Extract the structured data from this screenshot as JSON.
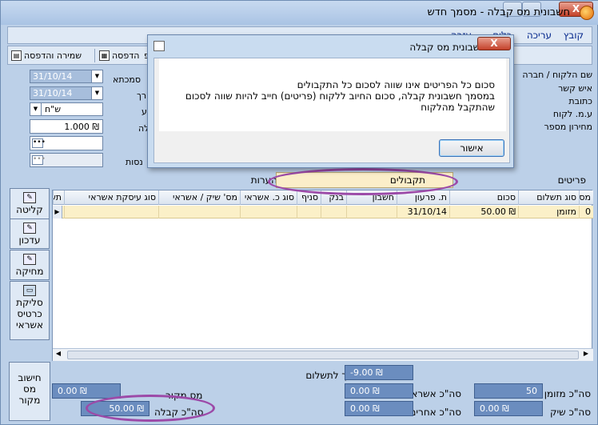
{
  "window": {
    "title": "חשבונית מס קבלה  -  מסמך חדש",
    "close": "X"
  },
  "menu": [
    "קובץ",
    "עריכה",
    "כלים",
    "עזרה"
  ],
  "toolbar": {
    "save_print": "שמירה והדפסה",
    "print": "הדפסה",
    "cut_label": "הכפ"
  },
  "header": {
    "customer_name": "שם הלקוח / חברה",
    "contact": "איש קשר",
    "address": "כתובת",
    "vat_id": "ע.מ. לקוח",
    "price_list": "מחירון מספר",
    "doc_label_cut": "סמכתא",
    "date_label_cut": "רך",
    "cur_label_cut": "ע",
    "rate_label_cut": "לה",
    "income_label_cut": "נסות",
    "date1": "31/10/14",
    "date2": "31/10/14",
    "currency": "ש\"ח",
    "rate": "1.000 ₪",
    "field_dots": "•••",
    "field_dots2": "•••"
  },
  "tabs": {
    "items": "פריטים",
    "notes": "הערות",
    "receipts": "תקבולים"
  },
  "side": {
    "receive": "קליטה",
    "update": "עדכון",
    "delete": "מחיקה",
    "swipe": "סליקת כרטיס אשראי"
  },
  "grid": {
    "columns": [
      "מס'",
      "סוג תשלום",
      "סכום",
      "ת. פרעון",
      "חשבון",
      "בנק",
      "סניף",
      "סוג כ. אשראי",
      "מס' שיק / אשראי",
      "סוג עיסקת אשראי",
      "תש"
    ],
    "row": [
      "0",
      "מזומן",
      "50.00 ₪",
      "31/10/14",
      "",
      "",
      "",
      "",
      "",
      "",
      ""
    ]
  },
  "bottom": {
    "calc_button": "חישוב מס מקור",
    "total_cash_label": "סה\"כ מזומן",
    "total_cash_value": "50",
    "total_check_label": "סה\"כ שיק",
    "total_check_value": "0.00 ₪",
    "total_credit_label": "סה\"כ אשראי",
    "total_credit_value": "0.00 ₪",
    "total_other_label": "סה\"כ אחרים",
    "total_other_value": "0.00 ₪",
    "balance_label": "יתרת מסמך לתשלום",
    "balance_value": "-9.00 ₪",
    "tax_label": "מס מקור",
    "tax_value": "0.00 ₪",
    "total_receipt_label": "סה\"כ קבלה",
    "total_receipt_value": "50.00 ₪"
  },
  "dialog": {
    "title": "חשבונית מס קבלה",
    "close": "X",
    "line1": "סכום כל הפריטים אינו שווה לסכום כל התקבולים",
    "line2": "במסמך חשבונית קבלה, סכום החיוב ללקוח (פריטים) חייב להיות שווה לסכום",
    "line3": "שהתקבל מהלקוח",
    "ok": "אישור"
  }
}
